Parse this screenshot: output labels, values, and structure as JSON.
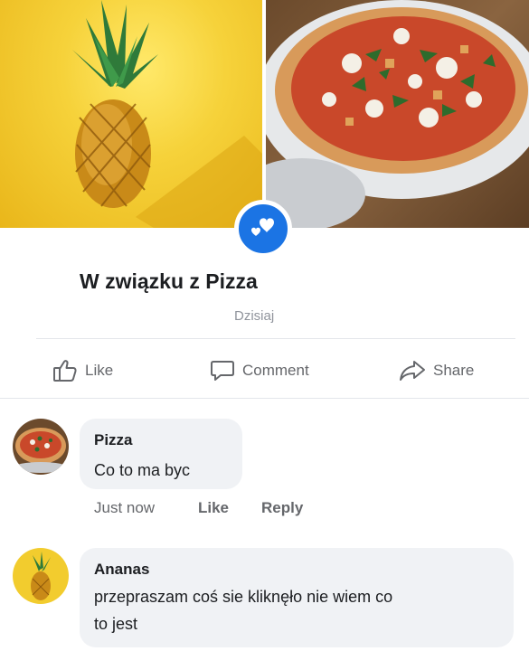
{
  "post": {
    "status_title": "W związku z Pizza",
    "date": "Dzisiaj",
    "cover": {
      "left_image": "pineapple-photo",
      "right_image": "pizza-photo",
      "badge_icon": "hearts-icon",
      "badge_color": "#1b74e4"
    }
  },
  "actions": {
    "like": "Like",
    "comment": "Comment",
    "share": "Share"
  },
  "comments": [
    {
      "name": "Pizza",
      "text": "Co to ma byc",
      "time": "Just now",
      "like": "Like",
      "reply": "Reply"
    },
    {
      "name": "Ananas",
      "text_line1": "przepraszam coś sie kliknęło nie wiem co",
      "text_line2": "to jest"
    }
  ]
}
